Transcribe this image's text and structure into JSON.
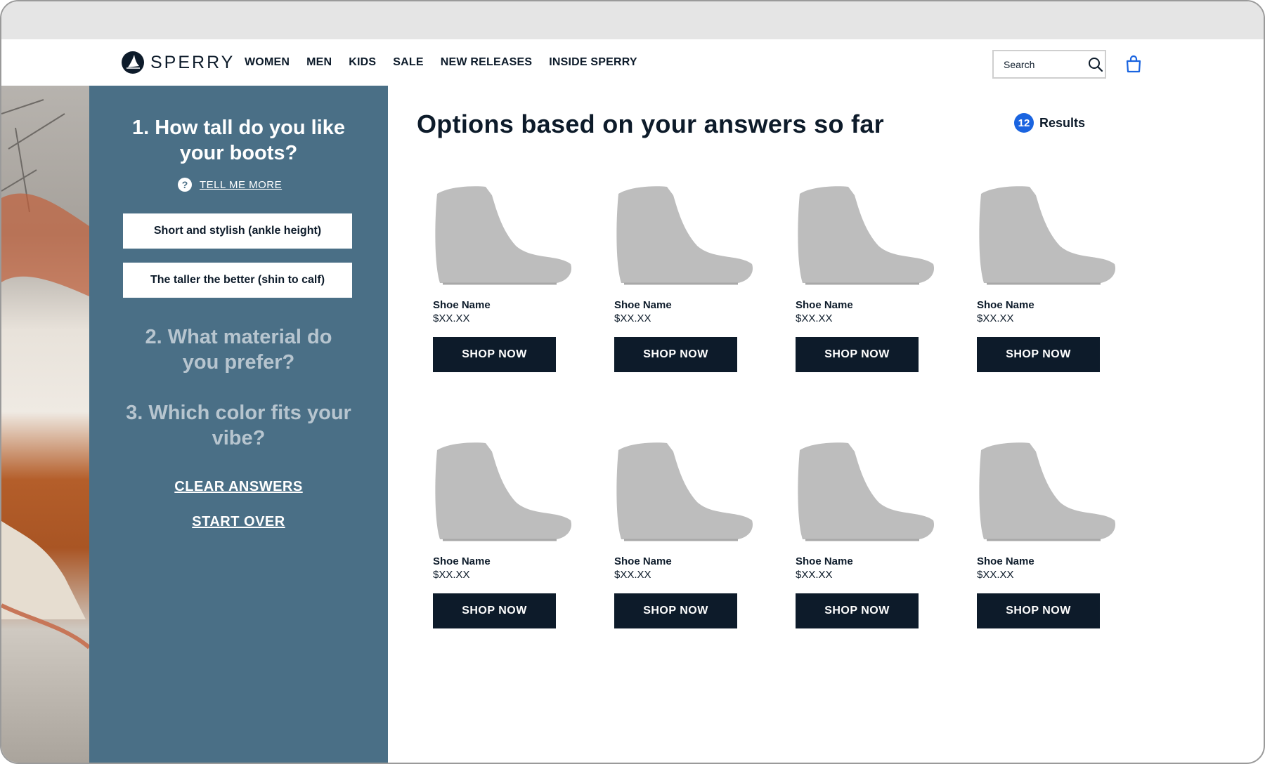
{
  "header": {
    "brand": "SPERRY",
    "nav": [
      "WOMEN",
      "MEN",
      "KIDS",
      "SALE",
      "NEW RELEASES",
      "INSIDE SPERRY"
    ],
    "search_placeholder": "Search",
    "icons": [
      "sperry-logo-icon",
      "search-icon",
      "shopping-bag-icon"
    ]
  },
  "quiz": {
    "question1": "1. How tall do you like your boots?",
    "tell_more": "TELL ME MORE",
    "options": [
      "Short and stylish (ankle height)",
      "The taller the better (shin to calf)"
    ],
    "question2": "2. What material do you prefer?",
    "question3": "3. Which color fits your vibe?",
    "clear": "CLEAR ANSWERS",
    "start_over": "START OVER"
  },
  "results": {
    "title": "Options based on your answers so far",
    "count": "12",
    "label": "Results"
  },
  "products": [
    {
      "name": "Shoe Name",
      "price": "$XX.XX",
      "cta": "SHOP NOW"
    },
    {
      "name": "Shoe Name",
      "price": "$XX.XX",
      "cta": "SHOP NOW"
    },
    {
      "name": "Shoe Name",
      "price": "$XX.XX",
      "cta": "SHOP NOW"
    },
    {
      "name": "Shoe Name",
      "price": "$XX.XX",
      "cta": "SHOP NOW"
    },
    {
      "name": "Shoe Name",
      "price": "$XX.XX",
      "cta": "SHOP NOW"
    },
    {
      "name": "Shoe Name",
      "price": "$XX.XX",
      "cta": "SHOP NOW"
    },
    {
      "name": "Shoe Name",
      "price": "$XX.XX",
      "cta": "SHOP NOW"
    },
    {
      "name": "Shoe Name",
      "price": "$XX.XX",
      "cta": "SHOP NOW"
    }
  ],
  "colors": {
    "navy": "#0d1b2a",
    "quiz_panel": "#4a6f86",
    "muted_question": "#b7c5cf",
    "results_badge": "#1a64e0",
    "boot_placeholder": "#bdbdbd"
  }
}
